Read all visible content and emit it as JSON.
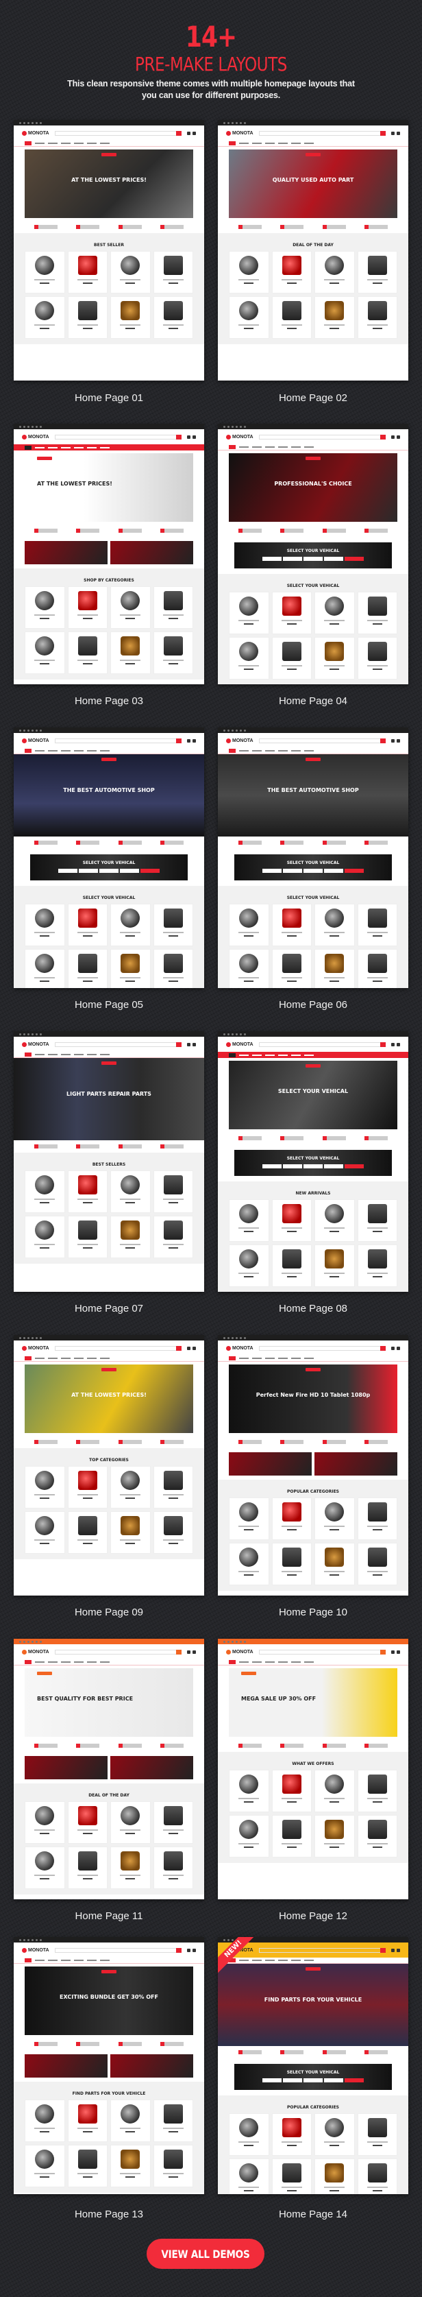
{
  "hero": {
    "count": "14+",
    "title": "PRE-MAKE LAYOUTS",
    "subtitle": "This clean responsive theme comes with multiple homepage layouts that you can use for different purposes."
  },
  "brand": {
    "name": "MONOTA",
    "accent_color": "#f22c3a",
    "background_color": "#25262a"
  },
  "demos": [
    {
      "label": "Home Page 01",
      "headline": "AT THE LOWEST PRICES!",
      "section": "BEST SELLER"
    },
    {
      "label": "Home Page 02",
      "headline": "QUALITY USED AUTO PART",
      "section": "DEAL OF THE DAY"
    },
    {
      "label": "Home Page 03",
      "headline": "AT THE LOWEST PRICES!",
      "section": "SHOP BY CATEGORIES"
    },
    {
      "label": "Home Page 04",
      "headline": "PROFESSIONAL'S CHOICE",
      "section": "SELECT YOUR VEHICAL"
    },
    {
      "label": "Home Page 05",
      "headline": "THE BEST AUTOMOTIVE SHOP",
      "section": "SELECT YOUR VEHICAL"
    },
    {
      "label": "Home Page 06",
      "headline": "THE BEST AUTOMOTIVE SHOP",
      "section": "SELECT YOUR VEHICAL"
    },
    {
      "label": "Home Page 07",
      "headline": "LIGHT PARTS  REPAIR PARTS",
      "section": "BEST SELLERS"
    },
    {
      "label": "Home Page 08",
      "headline": "SELECT YOUR VEHICAL",
      "section": "NEW ARRIVALS"
    },
    {
      "label": "Home Page 09",
      "headline": "AT THE LOWEST PRICES!",
      "section": "TOP CATEGORIES"
    },
    {
      "label": "Home Page 10",
      "headline": "Perfect New Fire HD 10 Tablet 1080p",
      "section": "POPULAR CATEGORIES"
    },
    {
      "label": "Home Page 11",
      "headline": "BEST QUALITY FOR BEST PRICE",
      "section": "DEAL OF THE DAY"
    },
    {
      "label": "Home Page 12",
      "headline": "MEGA SALE UP 30% OFF",
      "section": "WHAT WE OFFERS"
    },
    {
      "label": "Home Page 13",
      "headline": "EXCITING BUNDLE GET 30% OFF",
      "section": "FIND PARTS FOR YOUR VEHICLE"
    },
    {
      "label": "Home Page 14",
      "headline": "FIND PARTS FOR YOUR VEHICLE",
      "section": "POPULAR CATEGORIES",
      "badge": "NEW!"
    }
  ],
  "cta": {
    "label": "VIEW ALL DEMOS"
  }
}
